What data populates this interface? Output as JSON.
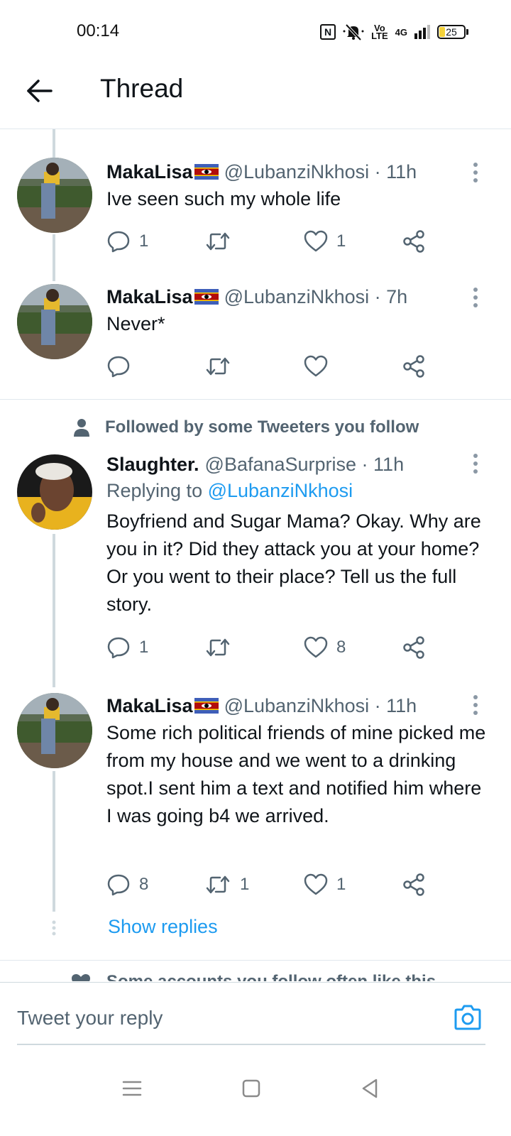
{
  "status": {
    "time": "00:14",
    "nfc": "N",
    "volte_top": "Vo",
    "volte_bottom": "LTE",
    "network": "4G",
    "battery": "25"
  },
  "header": {
    "title": "Thread"
  },
  "tweets": [
    {
      "name": "MakaLisa",
      "handle": "@LubanziNkhosi · 11h",
      "text": "Ive seen such my whole life",
      "replies": "1",
      "retweets": "",
      "likes": "1"
    },
    {
      "name": "MakaLisa",
      "handle": "@LubanziNkhosi · 7h",
      "text": "Never*",
      "replies": "",
      "retweets": "",
      "likes": ""
    },
    {
      "name": "Slaughter.",
      "handle": "@BafanaSurprise · 11h",
      "replying_prefix": "Replying to ",
      "replying_to": "@LubanziNkhosi",
      "text": "Boyfriend and Sugar Mama? Okay. Why are you in it? Did they attack you at your home? Or you went to their place? Tell us the full story.",
      "replies": "1",
      "retweets": "",
      "likes": "8"
    },
    {
      "name": "MakaLisa",
      "handle": "@LubanziNkhosi · 11h",
      "text": "Some rich political friends of mine picked me from my house and we went to a drinking spot.I sent him a text and notified him where I was going b4 we arrived.",
      "replies": "8",
      "retweets": "1",
      "likes": "1"
    }
  ],
  "followed_label": "Followed by some Tweeters you follow",
  "show_replies": "Show replies",
  "peek_label": "Some accounts you follow often like this",
  "reply": {
    "placeholder": "Tweet your reply"
  },
  "icons": {
    "back": "back-arrow-icon",
    "more": "more-vertical-icon",
    "reply": "reply-icon",
    "retweet": "retweet-icon",
    "like": "heart-icon",
    "share": "share-icon",
    "camera": "camera-icon",
    "person": "person-icon"
  },
  "colors": {
    "accent": "#1d9bf0",
    "secondary_text": "#536471",
    "thread_line": "#cfd9de"
  }
}
